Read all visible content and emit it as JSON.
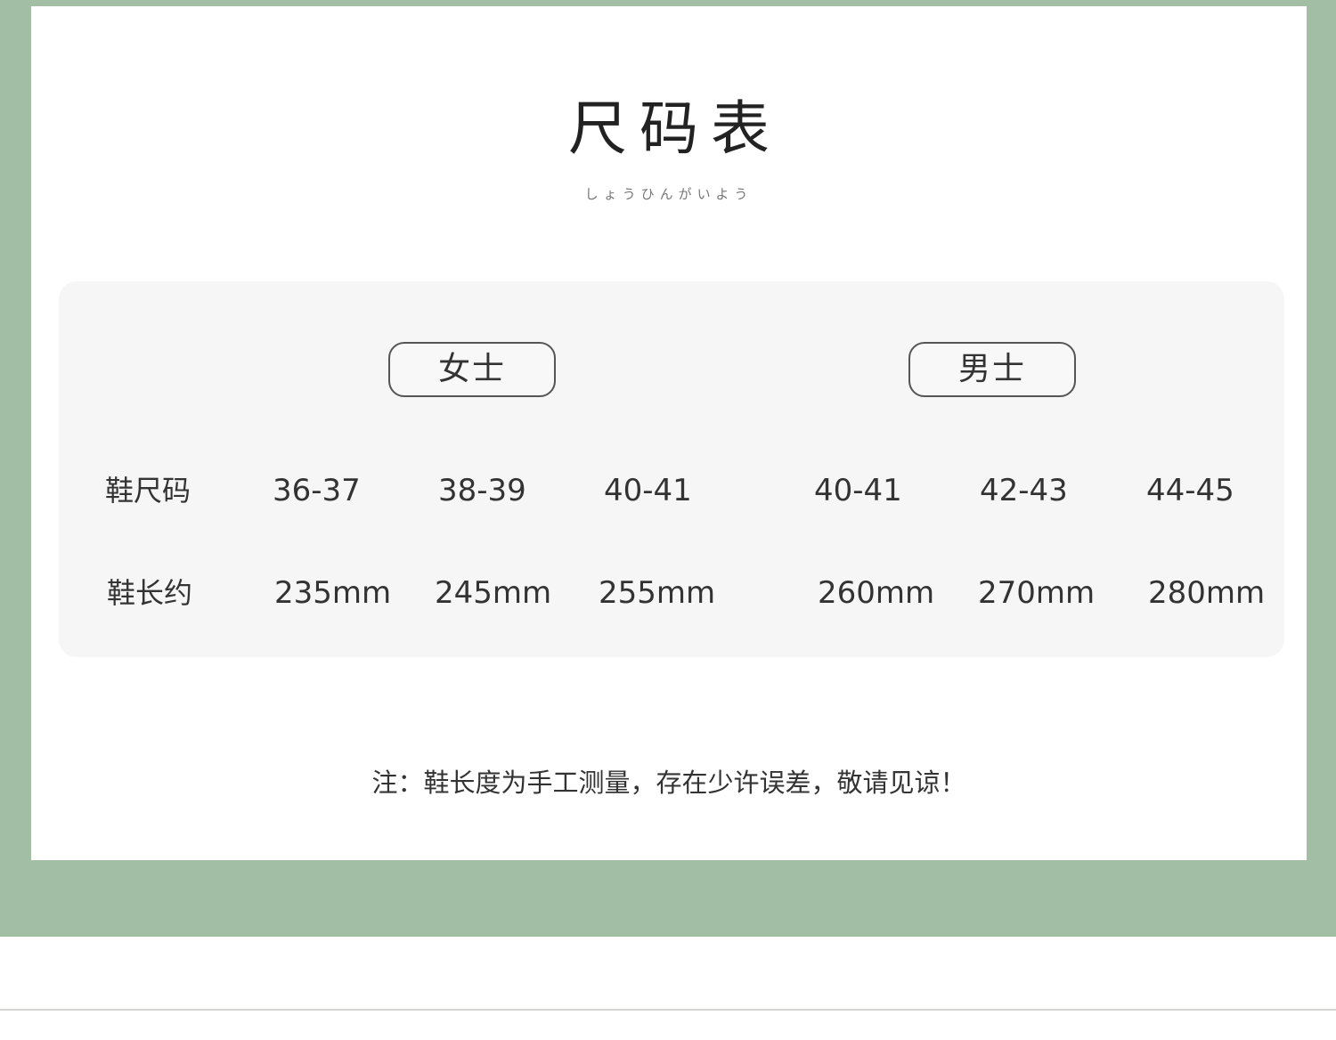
{
  "title": "尺码表",
  "subtitle": "しょうひんがいよう",
  "groups": {
    "women": "女士",
    "men": "男士"
  },
  "rows": {
    "size_label": "鞋尺码",
    "sizes": [
      "36-37",
      "38-39",
      "40-41",
      "40-41",
      "42-43",
      "44-45"
    ],
    "length_label": "鞋长约",
    "lengths": [
      "235mm",
      "245mm",
      "255mm",
      "260mm",
      "270mm",
      "280mm"
    ]
  },
  "note": "注：鞋长度为手工测量，存在少许误差，敬请见谅！",
  "colors": {
    "frame": "#a2bea4",
    "panel": "#f6f6f6",
    "text": "#333333"
  }
}
